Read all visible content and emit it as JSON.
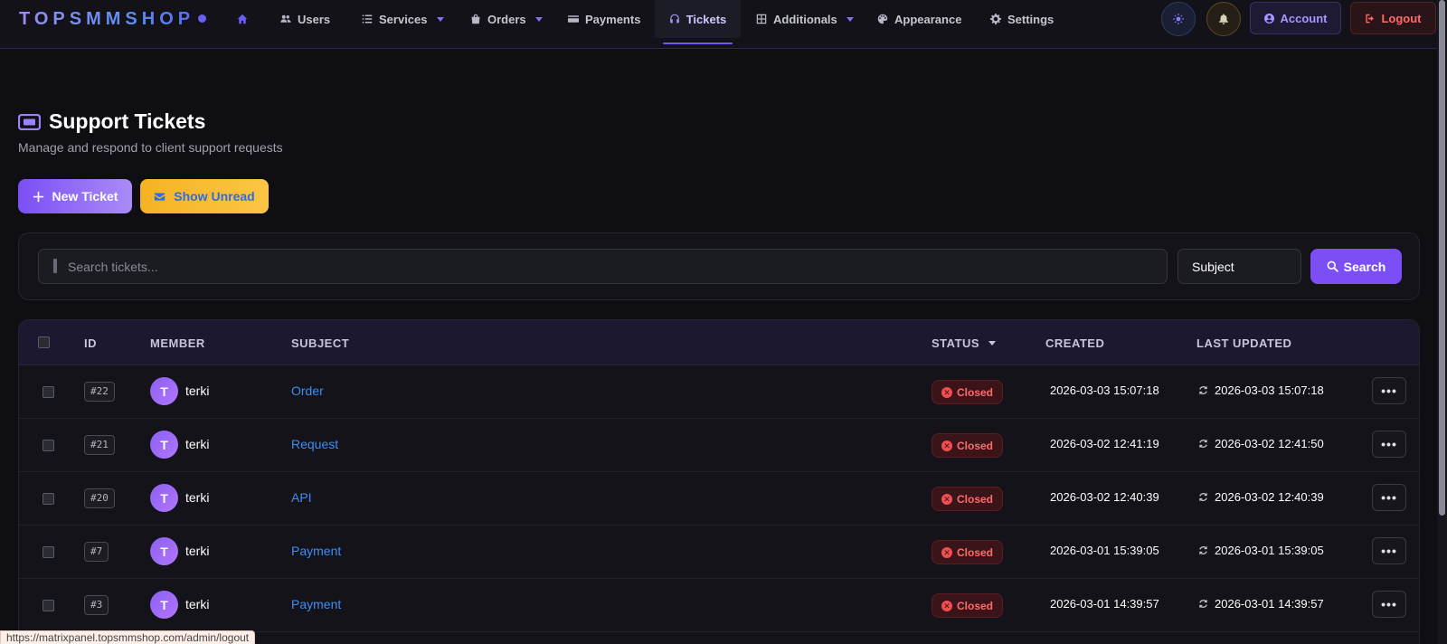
{
  "brand": {
    "name": "TOPSMMSHOP"
  },
  "nav": {
    "items": [
      {
        "label": "",
        "icon": "home-icon"
      },
      {
        "label": "Users",
        "icon": "users-icon"
      },
      {
        "label": "Services",
        "icon": "list-icon",
        "dropdown": true
      },
      {
        "label": "Orders",
        "icon": "bag-icon",
        "dropdown": true
      },
      {
        "label": "Payments",
        "icon": "card-icon"
      },
      {
        "label": "Tickets",
        "icon": "headset-icon",
        "active": true
      },
      {
        "label": "Additionals",
        "icon": "grid-icon",
        "dropdown": true
      },
      {
        "label": "Appearance",
        "icon": "palette-icon"
      },
      {
        "label": "Settings",
        "icon": "gear-icon"
      }
    ],
    "account_label": "Account",
    "logout_label": "Logout"
  },
  "header": {
    "title": "Support Tickets",
    "subtitle": "Manage and respond to client support requests",
    "new_ticket_label": "New Ticket",
    "show_unread_label": "Show Unread"
  },
  "search": {
    "placeholder": "Search tickets...",
    "field_selected": "Subject",
    "button_label": "Search"
  },
  "table": {
    "columns": [
      "ID",
      "MEMBER",
      "SUBJECT",
      "STATUS",
      "CREATED",
      "LAST UPDATED"
    ],
    "rows": [
      {
        "id": "#22",
        "avatar": "T",
        "member": "terki",
        "subject": "Order",
        "status": "Closed",
        "created": "2026-03-03 15:07:18",
        "updated": "2026-03-03 15:07:18",
        "actions": "•••"
      },
      {
        "id": "#21",
        "avatar": "T",
        "member": "terki",
        "subject": "Request",
        "status": "Closed",
        "created": "2026-03-02 12:41:19",
        "updated": "2026-03-02 12:41:50",
        "actions": "•••"
      },
      {
        "id": "#20",
        "avatar": "T",
        "member": "terki",
        "subject": "API",
        "status": "Closed",
        "created": "2026-03-02 12:40:39",
        "updated": "2026-03-02 12:40:39",
        "actions": "•••"
      },
      {
        "id": "#7",
        "avatar": "T",
        "member": "terki",
        "subject": "Payment",
        "status": "Closed",
        "created": "2026-03-01 15:39:05",
        "updated": "2026-03-01 15:39:05",
        "actions": "•••"
      },
      {
        "id": "#3",
        "avatar": "T",
        "member": "terki",
        "subject": "Payment",
        "status": "Closed",
        "created": "2026-03-01 14:39:57",
        "updated": "2026-03-01 14:39:57",
        "actions": "•••"
      }
    ]
  },
  "status_bar": {
    "url": "https://matrixpanel.topsmmshop.com/admin/logout"
  },
  "colors": {
    "accent": "#7b4ff5",
    "link": "#3d8ef5",
    "closed_status": "#ff6b6b",
    "warning_button": "#f5b323"
  }
}
